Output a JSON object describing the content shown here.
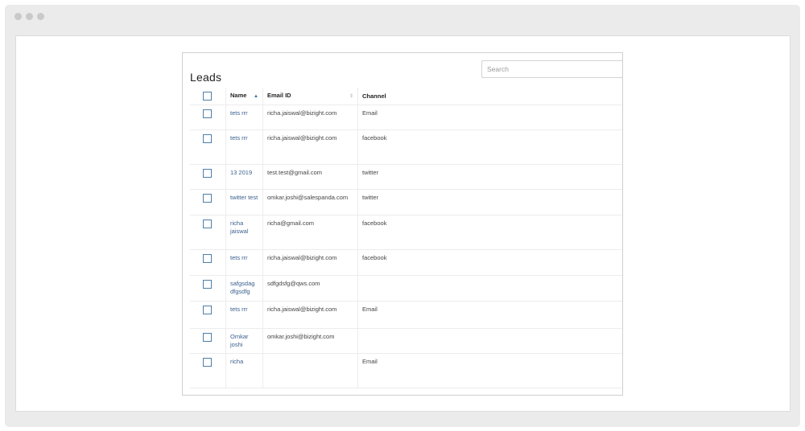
{
  "page": {
    "title": "Leads"
  },
  "search": {
    "placeholder": "Search"
  },
  "table": {
    "headers": {
      "name": "Name",
      "email": "Email ID",
      "channel": "Channel"
    },
    "rows": [
      {
        "name": "tets rrr",
        "email": "richa.jaiswal@bizight.com",
        "channel": "Email",
        "height": 31
      },
      {
        "name": "tets rrr",
        "email": "richa.jaiswal@bizight.com",
        "channel": "facebook",
        "height": 43
      },
      {
        "name": "13 2019",
        "email": "test.test@gmail.com",
        "channel": "twitter",
        "height": 31
      },
      {
        "name": "twitter test",
        "email": "omkar.joshi@salespanda.com",
        "channel": "twitter",
        "height": 32
      },
      {
        "name": "richa jaiswal",
        "email": "richa@gmail.com",
        "channel": "facebook",
        "height": 43
      },
      {
        "name": "tets rrr",
        "email": "richa.jaiswal@bizight.com",
        "channel": "facebook",
        "height": 32
      },
      {
        "name": "safgsdag dfgsdfg",
        "email": "sdfgdsfg@qws.com",
        "channel": "",
        "height": 32
      },
      {
        "name": "tets rrr",
        "email": "richa.jaiswal@bizight.com",
        "channel": "Email",
        "height": 34
      },
      {
        "name": "Omkar joshi",
        "email": "omkar.joshi@bizight.com",
        "channel": "",
        "height": 31
      },
      {
        "name": "richa",
        "email": "",
        "channel": "Email",
        "height": 43
      }
    ]
  }
}
